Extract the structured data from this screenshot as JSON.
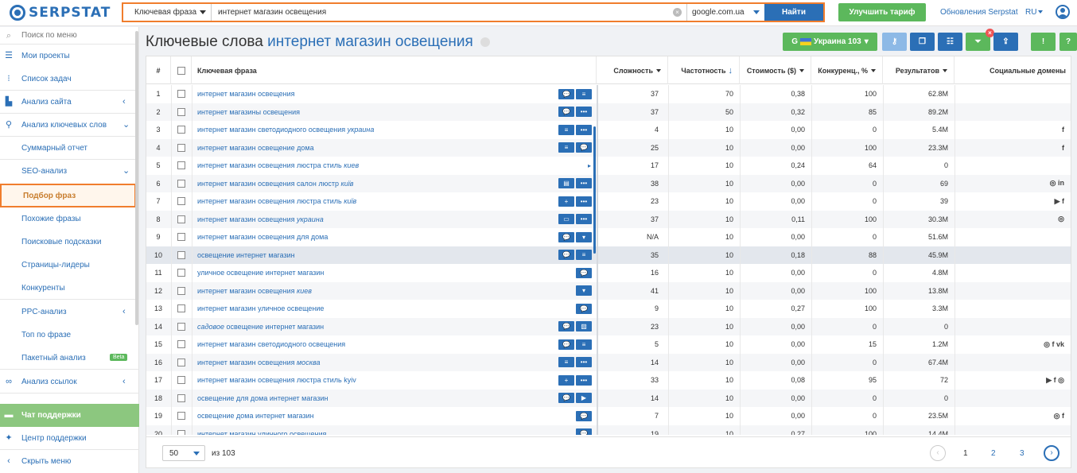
{
  "header": {
    "logo": "SERPSTAT",
    "search_type": "Ключевая фраза",
    "query": "интернет магазин освещения",
    "database": "google.com.ua",
    "search_button": "Найти",
    "upgrade_button": "Улучшить тариф",
    "updates_link": "Обновления Serpstat",
    "language": "RU"
  },
  "sidebar": {
    "search_menu": "Поиск по меню",
    "items": [
      {
        "label": "Мои проекты",
        "icon": "projects-icon"
      },
      {
        "label": "Список задач",
        "icon": "tasks-icon"
      },
      {
        "label": "Анализ сайта",
        "icon": "site-analysis-icon"
      },
      {
        "label": "Анализ ключевых слов",
        "icon": "keyword-analysis-icon"
      },
      {
        "label": "Суммарный отчет"
      },
      {
        "label": "SEO-анализ"
      },
      {
        "label": "Подбор фраз"
      },
      {
        "label": "Похожие фразы"
      },
      {
        "label": "Поисковые подсказки"
      },
      {
        "label": "Страницы-лидеры"
      },
      {
        "label": "Конкуренты"
      },
      {
        "label": "PPC-анализ"
      },
      {
        "label": "Топ по фразе"
      },
      {
        "label": "Пакетный анализ"
      },
      {
        "label": "Анализ ссылок",
        "icon": "link-analysis-icon"
      },
      {
        "label": "Чат поддержки",
        "icon": "chat-icon"
      },
      {
        "label": "Центр поддержки",
        "icon": "support-center-icon"
      },
      {
        "label": "Скрыть меню",
        "icon": "hide-menu-icon"
      }
    ],
    "beta_badge": "Beta"
  },
  "main": {
    "title_prefix": "Ключевые слова",
    "title_query": "интернет магазин освещения",
    "region_button": "Украина 103",
    "columns": {
      "num": "#",
      "keyword": "Ключевая фраза",
      "difficulty": "Сложность",
      "frequency": "Частотность",
      "cost": "Стоимость ($)",
      "competition": "Конкуренц., %",
      "results": "Результатов",
      "social": "Социальные домены"
    }
  },
  "rows": [
    {
      "n": "1",
      "kw": "интернет магазин освещения",
      "kw_it": "",
      "icons": [
        "💬",
        "≡"
      ],
      "d": "37",
      "f": "70",
      "c": "0,38",
      "comp": "100",
      "r": "62.8M",
      "soc": ""
    },
    {
      "n": "2",
      "kw": "интернет магазины освещения",
      "kw_it": "",
      "icons": [
        "💬",
        "•••"
      ],
      "d": "37",
      "f": "50",
      "c": "0,32",
      "comp": "85",
      "r": "89.2M",
      "soc": ""
    },
    {
      "n": "3",
      "kw": "интернет магазин светодиодного освещения ",
      "kw_it": "украина",
      "icons": [
        "≡",
        "•••"
      ],
      "d": "4",
      "f": "10",
      "c": "0,00",
      "comp": "0",
      "r": "5.4M",
      "soc": "f"
    },
    {
      "n": "4",
      "kw": "интернет магазин освещение дома",
      "kw_it": "",
      "icons": [
        "≡",
        "💬"
      ],
      "d": "25",
      "f": "10",
      "c": "0,00",
      "comp": "100",
      "r": "23.3M",
      "soc": "f"
    },
    {
      "n": "5",
      "kw": "интернет магазин освещения люстра стиль ",
      "kw_it": "киев",
      "icons": [],
      "d": "17",
      "f": "10",
      "c": "0,24",
      "comp": "64",
      "r": "0",
      "soc": ""
    },
    {
      "n": "6",
      "kw": "интернет магазин освещения салон люстр ",
      "kw_it": "київ",
      "icons": [
        "▤",
        "•••"
      ],
      "d": "38",
      "f": "10",
      "c": "0,00",
      "comp": "0",
      "r": "69",
      "soc": "◎ in"
    },
    {
      "n": "7",
      "kw": "интернет магазин освещения люстра стиль ",
      "kw_it": "київ",
      "icons": [
        "+",
        "•••"
      ],
      "d": "23",
      "f": "10",
      "c": "0,00",
      "comp": "0",
      "r": "39",
      "soc": "▶ f"
    },
    {
      "n": "8",
      "kw": "интернет магазин освещения ",
      "kw_it": "украина",
      "icons": [
        "▭",
        "•••"
      ],
      "d": "37",
      "f": "10",
      "c": "0,11",
      "comp": "100",
      "r": "30.3M",
      "soc": "◎"
    },
    {
      "n": "9",
      "kw": "интернет магазин освещения для дома",
      "kw_it": "",
      "icons": [
        "💬",
        "▾"
      ],
      "d": "N/A",
      "f": "10",
      "c": "0,00",
      "comp": "0",
      "r": "51.6M",
      "soc": ""
    },
    {
      "n": "10",
      "kw": "освещение интернет магазин",
      "kw_it": "",
      "icons": [
        "💬",
        "≡"
      ],
      "d": "35",
      "f": "10",
      "c": "0,18",
      "comp": "88",
      "r": "45.9M",
      "soc": ""
    },
    {
      "n": "11",
      "kw": "уличное освещение интернет магазин",
      "kw_it": "",
      "icons": [
        "💬"
      ],
      "d": "16",
      "f": "10",
      "c": "0,00",
      "comp": "0",
      "r": "4.8M",
      "soc": ""
    },
    {
      "n": "12",
      "kw": "интернет магазин освещения ",
      "kw_it": "киев",
      "icons": [
        "▾"
      ],
      "d": "41",
      "f": "10",
      "c": "0,00",
      "comp": "100",
      "r": "13.8M",
      "soc": ""
    },
    {
      "n": "13",
      "kw": "интернет магазин уличное освещение",
      "kw_it": "",
      "icons": [
        "💬"
      ],
      "d": "9",
      "f": "10",
      "c": "0,27",
      "comp": "100",
      "r": "3.3M",
      "soc": ""
    },
    {
      "n": "14",
      "kw_pre": "садовое",
      "kw": " освещение интернет магазин",
      "kw_it": "",
      "icons": [
        "💬",
        "▨"
      ],
      "d": "23",
      "f": "10",
      "c": "0,00",
      "comp": "0",
      "r": "0",
      "soc": ""
    },
    {
      "n": "15",
      "kw": "интернет магазин светодиодного освещения",
      "kw_it": "",
      "icons": [
        "💬",
        "≡"
      ],
      "d": "5",
      "f": "10",
      "c": "0,00",
      "comp": "15",
      "r": "1.2M",
      "soc": "◎ f vk"
    },
    {
      "n": "16",
      "kw": "интернет магазин освещения ",
      "kw_it": "москва",
      "icons": [
        "≡",
        "•••"
      ],
      "d": "14",
      "f": "10",
      "c": "0,00",
      "comp": "0",
      "r": "67.4M",
      "soc": ""
    },
    {
      "n": "17",
      "kw": "интернет магазин освещения люстра стиль kyiv",
      "kw_it": "",
      "icons": [
        "+",
        "•••"
      ],
      "d": "33",
      "f": "10",
      "c": "0,08",
      "comp": "95",
      "r": "72",
      "soc": "▶ f ◎"
    },
    {
      "n": "18",
      "kw": "освещение для дома интернет магазин",
      "kw_it": "",
      "icons": [
        "💬",
        "▶"
      ],
      "d": "14",
      "f": "10",
      "c": "0,00",
      "comp": "0",
      "r": "0",
      "soc": ""
    },
    {
      "n": "19",
      "kw": "освещение дома интернет магазин",
      "kw_it": "",
      "icons": [
        "💬"
      ],
      "d": "7",
      "f": "10",
      "c": "0,00",
      "comp": "0",
      "r": "23.5M",
      "soc": "◎ f"
    },
    {
      "n": "20",
      "kw": "интернет магазин уличного освещения",
      "kw_it": "",
      "icons": [
        "💬"
      ],
      "d": "19",
      "f": "10",
      "c": "0,27",
      "comp": "100",
      "r": "14.4M",
      "soc": ""
    }
  ],
  "footer": {
    "per_page": "50",
    "of_total": "из 103",
    "pages": [
      "1",
      "2",
      "3"
    ]
  },
  "colors": {
    "brand_blue": "#2b6fb6",
    "accent_orange": "#f07d2d",
    "green": "#5cb85c"
  }
}
